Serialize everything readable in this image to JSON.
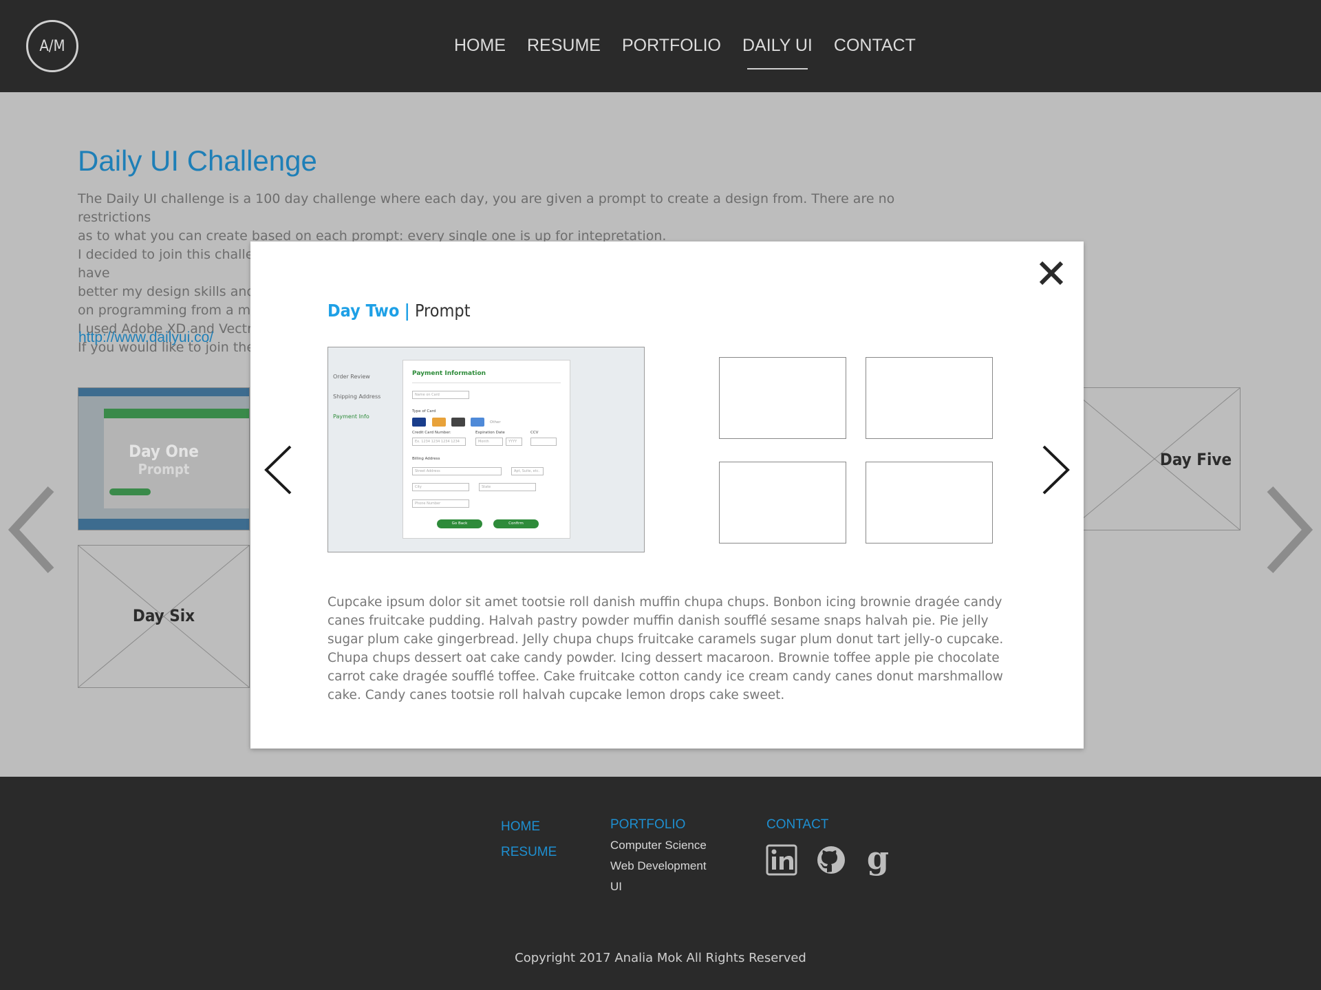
{
  "header": {
    "logo_text": "A/M",
    "nav": [
      {
        "label": "HOME"
      },
      {
        "label": "RESUME"
      },
      {
        "label": "PORTFOLIO"
      },
      {
        "label": "DAILY UI",
        "active": true
      },
      {
        "label": "CONTACT"
      }
    ]
  },
  "main": {
    "title": "Daily UI Challenge",
    "intro_lines": [
      "The Daily UI challenge is a 100 day challenge where each day, you are given a prompt to create a design from. There are no restrictions",
      "as to what you can create based on each prompt: every single one is up for intepretation.",
      "I decided to join this challenge because of my recent interest in UI design. Hopefully after completing the 100 days, I will have",
      "better my design skills and fo",
      "on programming from a mo",
      "I used Adobe XD and Vectr t",
      "If you would like to join the c"
    ],
    "link": "http://www.dailyui.co/",
    "thumbs": {
      "day_one": {
        "label": "Day One",
        "sub": "Prompt"
      },
      "day_five": {
        "label": "Day Five"
      },
      "day_six": {
        "label": "Day Six"
      }
    }
  },
  "modal": {
    "title_day": "Day Two",
    "title_sep": "|",
    "title_prompt": "Prompt",
    "screenshot": {
      "sidebar": [
        "Order Review",
        "Shipping Address",
        "Payment Info"
      ],
      "card_title": "Payment Information",
      "name_placeholder": "Name on Card",
      "type_label": "Type of Card",
      "other_label": "Other",
      "cc_label": "Credit Card Number:",
      "cc_placeholder": "Ex. 1234 1234 1234 1234",
      "exp_label": "Expiration Date",
      "month_placeholder": "Month",
      "year_placeholder": "YYYY",
      "ccv_label": "CCV",
      "billing_label": "Billing Address",
      "street_placeholder": "Street Address",
      "apt_placeholder": "Apt, Suite, etc.",
      "city_placeholder": "City",
      "state_placeholder": "State",
      "phone_placeholder": "Phone Number",
      "back_label": "Go Back",
      "confirm_label": "Confirm"
    },
    "body": "Cupcake ipsum dolor sit amet tootsie roll danish muffin chupa chups. Bonbon icing brownie dragée candy canes fruitcake pudding. Halvah pastry powder muffin danish soufflé sesame snaps halvah pie. Pie jelly sugar plum cake gingerbread. Jelly chupa chups fruitcake caramels sugar plum donut tart jelly-o cupcake. Chupa chups dessert oat cake candy powder. Icing dessert macaroon. Brownie toffee apple pie chocolate carrot cake dragée soufflé toffee. Cake fruitcake cotton candy ice cream candy canes donut marshmallow cake. Candy canes tootsie roll halvah cupcake lemon drops cake sweet."
  },
  "footer": {
    "home": "HOME",
    "resume": "RESUME",
    "portfolio": "PORTFOLIO",
    "portfolio_items": [
      "Computer Science",
      "Web Development",
      "UI"
    ],
    "contact": "CONTACT",
    "social_icons": [
      "linkedin-icon",
      "github-icon",
      "google-icon"
    ],
    "copyright": "Copyright 2017 Analia Mok All Rights Reserved"
  },
  "colors": {
    "accent_blue": "#1e7fb7",
    "modal_day_blue": "#1ea0e6",
    "header_bg": "#2a2a2a",
    "overlay_gray": "#bdbdbd",
    "green": "#2e8b3a"
  }
}
